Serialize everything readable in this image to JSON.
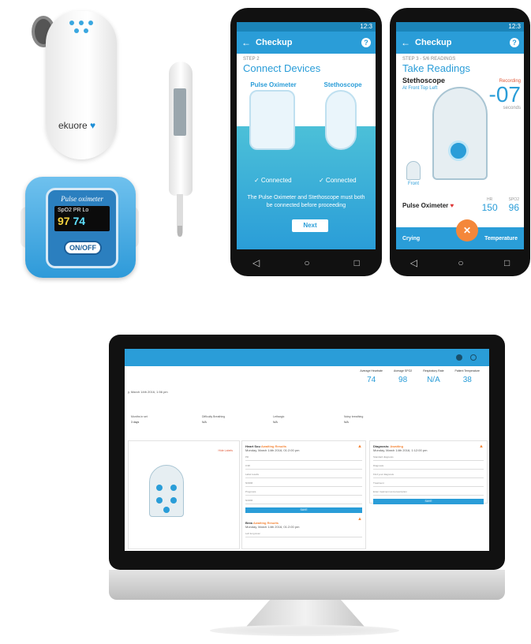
{
  "devices": {
    "stethoscope_brand": "ekuore",
    "oximeter_title": "Pulse oximeter",
    "oximeter_readout_labels": "SpO2 PR Lo",
    "oximeter_spo2": "97",
    "oximeter_pr": "74",
    "oximeter_button": "ON/OFF"
  },
  "phone1": {
    "app_title": "Checkup",
    "step": "STEP 2",
    "heading": "Connect Devices",
    "col1": "Pulse Oximeter",
    "col2": "Stethoscope",
    "connected1": "✓ Connected",
    "connected2": "✓ Connected",
    "message": "The Pulse Oximeter and Stethoscope must both be connected before proceeding",
    "next": "Next",
    "time": "12:3"
  },
  "phone2": {
    "app_title": "Checkup",
    "step": "STEP 3 - 5/6 READINGS",
    "heading": "Take Readings",
    "sub": "Stethoscope",
    "location": "At Front Top Left",
    "recording_label": "Recording",
    "countdown": "-07",
    "countdown_unit": "seconds",
    "front_label": "Front",
    "pulse_label": "Pulse Oximeter",
    "hr_label": "HR",
    "hr": "150",
    "spo2_label": "SPO2",
    "spo2": "96",
    "left_action": "Crying",
    "right_action": "Temperature",
    "time": "12:3"
  },
  "desktop": {
    "vitals": [
      {
        "label": "Average Heartrate",
        "value": "74"
      },
      {
        "label": "Average SPO2",
        "value": "98"
      },
      {
        "label": "Respiratory Rate",
        "value": "N/A"
      },
      {
        "label": "Patient Temperature",
        "value": "38"
      }
    ],
    "date": "y, March 14th 2016, 1:56 pm",
    "info": [
      {
        "label": "Months in set",
        "value": "3 days"
      },
      {
        "label": "Difficulty Breathing",
        "value": "N/A"
      },
      {
        "label": "Lethargic",
        "value": "N/A"
      },
      {
        "label": "Noisy breathing",
        "value": "N/A"
      }
    ],
    "hide_labels": "Hide Labels",
    "card1_title": "Heart Sou",
    "card1_status": "Awaiting Results",
    "card1_date": "Monday, March 14th 2016, 01:2:00 pm",
    "card1_fields": [
      "Pill",
      "0:38",
      "Label results",
      "NORM",
      "Prognosis",
      "NORM"
    ],
    "card1_button": "SAVE",
    "card2_title": "Brea",
    "card2_status": "Awaiting Results",
    "card2_date": "Monday, March 14th 2016, 01:2:00 pm",
    "card2_field": "Left lung Ausc",
    "card3_title": "Diagnosis:",
    "card3_status": "Awaiting",
    "card3_date": "Monday, March 14th 2016, 1:12:00 pm",
    "card3_fields": [
      "Standard diagnosis",
      "Diagnosis",
      "Find your diagnosis",
      "Treatment",
      "Enter treatment and prescription"
    ],
    "card3_button": "SAVE"
  }
}
